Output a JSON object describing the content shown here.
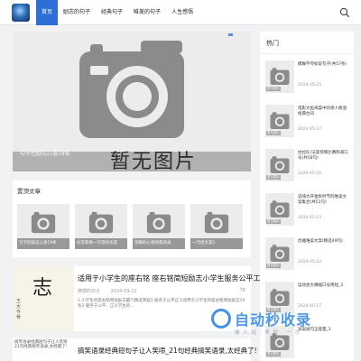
{
  "nav": {
    "items": [
      "首页",
      "励志的句子",
      "经典句子",
      "唯美的句子",
      "人生感悟"
    ],
    "active_index": 0
  },
  "hero": {
    "title": "句子控励志心语19条",
    "placeholder_text": "暂无图片"
  },
  "top_articles": {
    "heading": "置顶文章",
    "items": [
      {
        "caption": "句子控励志心语19条"
      },
      {
        "caption": "抖音新奇一句话的文案"
      },
      {
        "caption": "温暖的心语经典语录"
      },
      {
        "caption": "一句话文案1"
      }
    ]
  },
  "posts": [
    {
      "title": "适用于小学生的座右铭 座右铭简短励志小学生服务公平工正",
      "author": "微感的句子",
      "date": "2024-09-22",
      "views": "78",
      "excerpt": "1.小学生的座右铭简短励志霸气精选简短1.服务于公平正义适用于小学生的座右铭简短励志10条2.服务于公平、正义学生的...",
      "thumb_big": "志",
      "thumb_small": "王\n大\n今\n骨"
    },
    {
      "title": "搞笑语录经典短句子让人笑喷_21句经典搞笑语录,太经典了!",
      "thumb_alt": "搞笑语录经典短句子让人笑喷 21句经典搞笑语录,太经典了!"
    }
  ],
  "sidebar": {
    "heading": "热门",
    "items": [
      {
        "text": "模糊不夸如说句子(共57条)",
        "date": "2024-05-15",
        "thumb": "暂无图片"
      },
      {
        "text": "电影大鱼海棠中的感人催泪经典台词",
        "date": "2024-05-17",
        "thumb": "暂无图片"
      },
      {
        "text": "拉拉队(法案惊悚比赛和减口号(共58句)",
        "date": "2024-05-16",
        "thumb": "暂无图片"
      },
      {
        "text": "说嗨大开金秋时节的唯美文案集合(共51句)",
        "date": "2024-05-13",
        "thumb": "暂无图片"
      },
      {
        "text": "优雅唯美文案(精选49句)",
        "date": "2024-05-22",
        "thumb": "暂无图片"
      },
      {
        "text": "运动会大横幅口号简短_3",
        "date": "2024-05-17",
        "thumb": "暂无图片"
      },
      {
        "text": "早安短句正能量_3",
        "date": "",
        "thumb": "暂无图片"
      }
    ]
  },
  "watermark": {
    "text": "自动秒收录",
    "sub": "做 人 站 · 来 秒 · 一 次"
  },
  "colors": {
    "accent": "#2d6fd6",
    "watermark": "#2f86e6"
  }
}
